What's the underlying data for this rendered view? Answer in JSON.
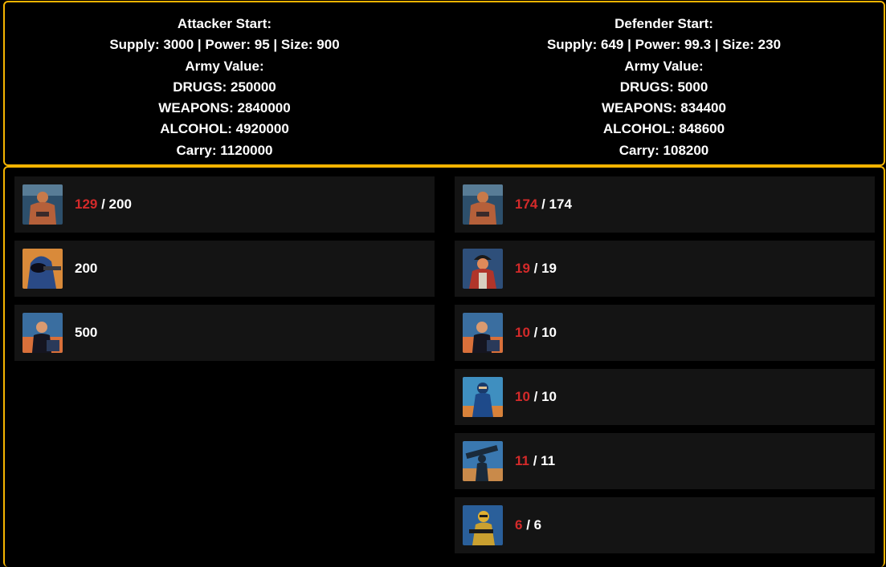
{
  "colors": {
    "border": "#f5b400",
    "remaining": "#d42a2a",
    "row_bg": "#141414"
  },
  "attacker": {
    "title": "Attacker Start:",
    "stats": "Supply: 3000 | Power: 95 | Size: 900",
    "army_label": "Army Value:",
    "drugs": "DRUGS: 250000",
    "weapons": "WEAPONS: 2840000",
    "alcohol": "ALCOHOL: 4920000",
    "carry": "Carry: 1120000",
    "units": [
      {
        "icon": "bruiser-portrait-icon",
        "remaining": "129",
        "sep": " / ",
        "total": "200"
      },
      {
        "icon": "hooded-gunman-portrait-icon",
        "remaining": "",
        "sep": "",
        "total": "200"
      },
      {
        "icon": "suited-man-portrait-icon",
        "remaining": "",
        "sep": "",
        "total": "500"
      }
    ]
  },
  "defender": {
    "title": "Defender Start:",
    "stats": "Supply: 649 | Power: 99.3 | Size: 230",
    "army_label": "Army Value:",
    "drugs": "DRUGS: 5000",
    "weapons": "WEAPONS: 834400",
    "alcohol": "ALCOHOL: 848600",
    "carry": "Carry: 108200",
    "units": [
      {
        "icon": "bruiser-portrait-icon",
        "remaining": "174",
        "sep": " / ",
        "total": "174"
      },
      {
        "icon": "chef-portrait-icon",
        "remaining": "19",
        "sep": " / ",
        "total": "19"
      },
      {
        "icon": "suited-man-portrait-icon",
        "remaining": "10",
        "sep": " / ",
        "total": "10"
      },
      {
        "icon": "ninja-portrait-icon",
        "remaining": "10",
        "sep": " / ",
        "total": "10"
      },
      {
        "icon": "soldier-launcher-portrait-icon",
        "remaining": "11",
        "sep": " / ",
        "total": "11"
      },
      {
        "icon": "armored-soldier-portrait-icon",
        "remaining": "6",
        "sep": " / ",
        "total": "6"
      }
    ]
  }
}
